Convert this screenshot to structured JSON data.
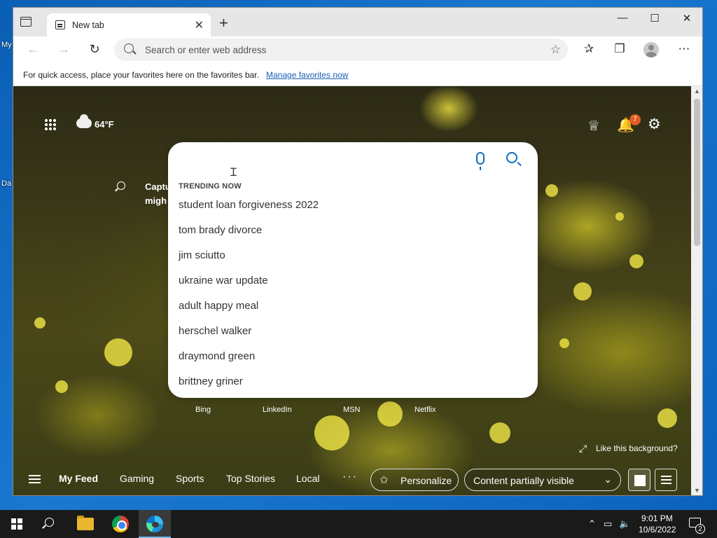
{
  "desktop": {
    "icon_labels": [
      "My",
      "Da"
    ]
  },
  "tab": {
    "title": "New tab",
    "close": "✕"
  },
  "new_tab_symbol": "+",
  "window_controls": {
    "minimize": "—",
    "maximize": "☐",
    "close": "✕"
  },
  "toolbar": {
    "back": "←",
    "forward": "→",
    "refresh": "↻",
    "address_placeholder": "Search or enter web address",
    "more": "⋯"
  },
  "favbar": {
    "text": "For quick access, place your favorites here on the favorites bar.",
    "link": "Manage favorites now"
  },
  "header": {
    "temperature": "64°F",
    "notification_count": "7"
  },
  "snippet": {
    "line1": "Captu",
    "line2": "migh"
  },
  "search": {
    "trending_label": "TRENDING NOW",
    "trending": [
      "student loan forgiveness 2022",
      "tom brady divorce",
      "jim sciutto",
      "ukraine war update",
      "adult happy meal",
      "herschel walker",
      "draymond green",
      "brittney griner"
    ]
  },
  "quicklinks": [
    "Bing",
    "LinkedIn",
    "MSN",
    "Netflix"
  ],
  "background": {
    "like_label": "Like this background?"
  },
  "feed": {
    "tabs": [
      "My Feed",
      "Gaming",
      "Sports",
      "Top Stories",
      "Local"
    ],
    "more": "···",
    "personalize_label": "Personalize",
    "content_visibility": "Content partially visible"
  },
  "taskbar": {
    "time": "9:01 PM",
    "date": "10/6/2022",
    "notifications": "2"
  },
  "icons": {
    "apps": "apps-grid-icon",
    "weather": "cloud-icon",
    "rewards": "rewards-icon",
    "bell": "bell-icon",
    "settings": "gear-icon",
    "mic": "microphone-icon",
    "search": "search-icon"
  },
  "colors": {
    "accent": "#0f6cbd",
    "badge": "#e35b21",
    "taskbar": "#1a1a1a"
  }
}
